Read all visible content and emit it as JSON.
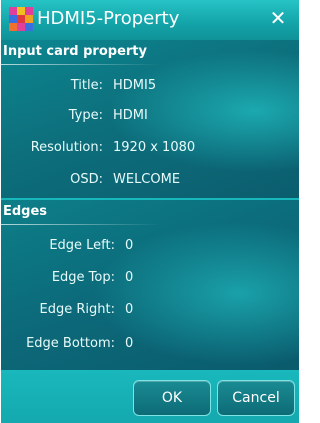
{
  "window": {
    "title": "HDMI5-Property",
    "close_symbol": "✕",
    "icon": "app-icon"
  },
  "input_card": {
    "header": "Input card property",
    "rows": [
      {
        "label": "Title:",
        "value": "HDMI5"
      },
      {
        "label": "Type:",
        "value": "HDMI"
      },
      {
        "label": "Resolution:",
        "value": "1920 x 1080"
      },
      {
        "label": "OSD:",
        "value": "WELCOME"
      }
    ]
  },
  "edges": {
    "header": "Edges",
    "rows": [
      {
        "label": "Edge Left:",
        "value": "0"
      },
      {
        "label": "Edge Top:",
        "value": "0"
      },
      {
        "label": "Edge Right:",
        "value": "0"
      },
      {
        "label": "Edge Bottom:",
        "value": "0"
      }
    ]
  },
  "buttons": {
    "ok": "OK",
    "cancel": "Cancel"
  },
  "colors": {
    "accent": "#19b8bc",
    "panel": "#0b6f7c",
    "text": "#e8fbfb"
  }
}
